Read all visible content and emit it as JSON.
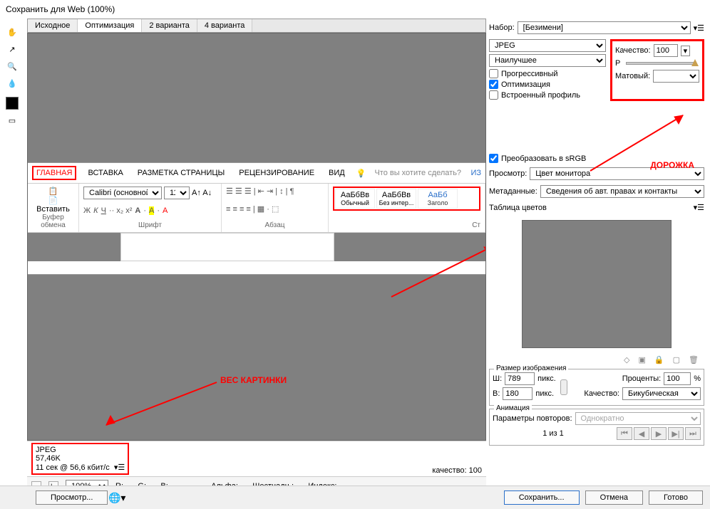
{
  "title": "Сохранить для Web (100%)",
  "tabs": [
    "Исходное",
    "Оптимизация",
    "2 варианта",
    "4 варианта"
  ],
  "active_tab": "Оптимизация",
  "word": {
    "tabs": [
      "ГЛАВНАЯ",
      "ВСТАВКА",
      "РАЗМЕТКА СТРАНИЦЫ",
      "РЕЦЕНЗИРОВАНИЕ",
      "ВИД"
    ],
    "tell_me": "Что вы хотите сделать?",
    "iz": "ИЗ",
    "paste": "Вставить",
    "font_name": "Calibri (основной)",
    "font_size": "11",
    "groups": {
      "clipboard": "Буфер обмена",
      "font": "Шрифт",
      "para": "Абзац",
      "styles": "Ст"
    },
    "styles": [
      {
        "sample": "АаБбВв",
        "name": "Обычный"
      },
      {
        "sample": "АаБбВв",
        "name": "Без интер..."
      },
      {
        "sample": "АаБб",
        "name": "Заголо"
      }
    ]
  },
  "info": {
    "format": "JPEG",
    "size": "57,46K",
    "time": "11 сек @ 56,6 кбит/с",
    "quality_label": "качество: 100"
  },
  "status": {
    "zoom": "100%",
    "r": "R: --",
    "g": "G: --",
    "b": "B: --",
    "alpha": "Альфа: --",
    "hex": "Шестнадц.: --",
    "index": "Индекс: --"
  },
  "right": {
    "preset_label": "Набор:",
    "preset": "[Безимени]",
    "format": "JPEG",
    "quality_preset": "Наилучшее",
    "progressive": "Прогрессивный",
    "optimized": "Оптимизация",
    "embed_profile": "Встроенный профиль",
    "quality_label": "Качество:",
    "quality_value": "100",
    "blur_label": "Р",
    "matte_label": "Матовый:",
    "convert_srgb": "Преобразовать в sRGB",
    "preview_label": "Просмотр:",
    "preview_value": "Цвет монитора",
    "metadata_label": "Метаданные:",
    "metadata_value": "Сведения об авт. правах и контакты",
    "color_table": "Таблица цветов",
    "image_size": "Размер изображения",
    "w_label": "Ш:",
    "w_value": "789",
    "h_label": "В:",
    "h_value": "180",
    "px": "пикс.",
    "percent_label": "Проценты:",
    "percent_value": "100",
    "percent_suffix": "%",
    "quality_label2": "Качество:",
    "resample": "Бикубическая",
    "animation": "Анимация",
    "loop_label": "Параметры повторов:",
    "loop_value": "Однократно",
    "frame": "1 из 1"
  },
  "annotations": {
    "track": "ДОРОЖКА",
    "weight": "ВЕС КАРТИНКИ"
  },
  "footer": {
    "preview": "Просмотр...",
    "save": "Сохранить...",
    "cancel": "Отмена",
    "done": "Готово"
  }
}
